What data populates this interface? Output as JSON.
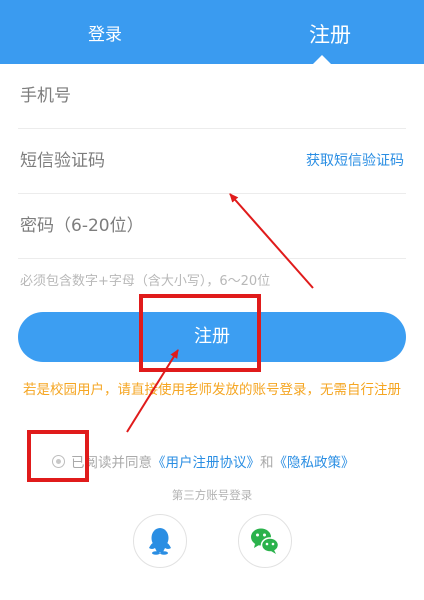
{
  "tabs": {
    "login": "登录",
    "register": "注册"
  },
  "form": {
    "phone_label": "手机号",
    "sms_label": "短信验证码",
    "sms_action": "获取短信验证码",
    "password_label": "密码（6-20位）",
    "password_hint": "必须包含数字+字母（含大小写），6～20位"
  },
  "submit_label": "注册",
  "annotation_note": "若是校园用户，请直接使用老师发放的账号登录，无需自行注册",
  "agreement": {
    "prefix": "已阅读并同意",
    "terms_link": "《用户注册协议》",
    "and": "和",
    "privacy_link": "《隐私政策》"
  },
  "third_party": {
    "label": "第三方账号登录",
    "providers": [
      "qq-icon",
      "wechat-icon"
    ]
  },
  "colors": {
    "header": "#3a9bf0",
    "button": "#3c9ef2",
    "link": "#2a8ee3",
    "annotation_red": "#e01b1b",
    "note_orange": "#f5a623"
  }
}
